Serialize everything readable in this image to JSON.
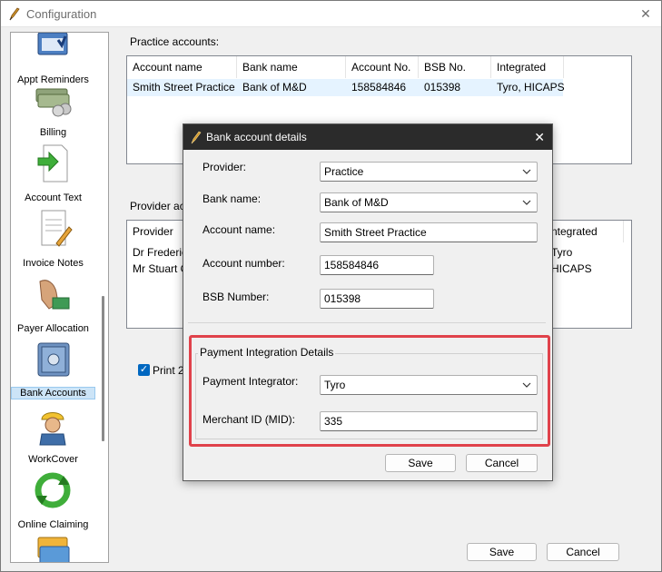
{
  "window": {
    "title": "Configuration",
    "close_glyph": "✕"
  },
  "sidebar": {
    "items": [
      {
        "label": "Appt Reminders",
        "icon": "calendar-icon"
      },
      {
        "label": "Billing",
        "icon": "money-stack-icon"
      },
      {
        "label": "Account Text",
        "icon": "document-arrow-icon"
      },
      {
        "label": "Invoice Notes",
        "icon": "notepad-pencil-icon"
      },
      {
        "label": "Payer Allocation",
        "icon": "hand-card-icon"
      },
      {
        "label": "Bank Accounts",
        "icon": "safe-icon",
        "selected": true
      },
      {
        "label": "WorkCover",
        "icon": "worker-icon"
      },
      {
        "label": "Online Claiming",
        "icon": "recycle-arrows-icon"
      }
    ]
  },
  "practice_accounts": {
    "label": "Practice accounts:",
    "columns": [
      "Account name",
      "Bank name",
      "Account No.",
      "BSB No.",
      "Integrated"
    ],
    "rows": [
      [
        "Smith Street Practice",
        "Bank of M&D",
        "158584846",
        "015398",
        "Tyro, HICAPS"
      ]
    ]
  },
  "provider_accounts": {
    "label_visible": "Provider acc",
    "columns_visible": [
      "Provider",
      "ntegrated"
    ],
    "rows_visible": [
      {
        "provider": "Dr Frederick",
        "integrated": "Tyro"
      },
      {
        "provider": "Mr Stuart G",
        "integrated": "HICAPS"
      }
    ]
  },
  "print_checkbox": {
    "label": "Print 2",
    "checked": true,
    "check_glyph": "✓"
  },
  "buttons": {
    "save": "Save",
    "cancel": "Cancel"
  },
  "dialog": {
    "title": "Bank account details",
    "close_glyph": "✕",
    "fields": {
      "provider": {
        "label": "Provider:",
        "value": "Practice"
      },
      "bank_name": {
        "label": "Bank name:",
        "value": "Bank of M&D"
      },
      "account_name": {
        "label": "Account name:",
        "value": "Smith Street Practice"
      },
      "account_number": {
        "label": "Account number:",
        "value": "158584846"
      },
      "bsb_number": {
        "label": "BSB Number:",
        "value": "015398"
      }
    },
    "payment_group": {
      "title": "Payment Integration Details",
      "integrator": {
        "label": "Payment Integrator:",
        "value": "Tyro"
      },
      "merchant_id": {
        "label": "Merchant ID (MID):",
        "value": "335"
      }
    },
    "buttons": {
      "save": "Save",
      "cancel": "Cancel"
    }
  },
  "colors": {
    "highlight": "#e0424b",
    "dialog_titlebar": "#2b2b2b",
    "selection": "#cce4f7",
    "checkbox": "#0067c0"
  }
}
